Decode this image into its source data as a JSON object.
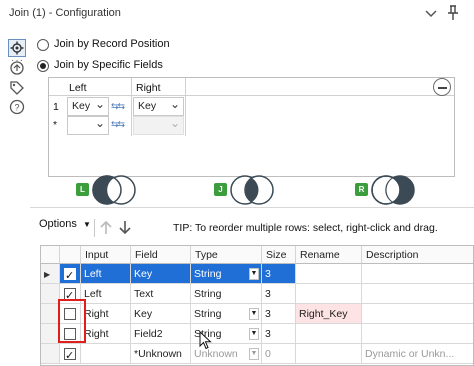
{
  "window": {
    "title": "Join (1) - Configuration"
  },
  "join_modes": {
    "record_position": "Join by Record Position",
    "specific_fields": "Join by Specific Fields"
  },
  "join_grid": {
    "headers": {
      "left": "Left",
      "right": "Right"
    },
    "rows": [
      {
        "num": "1",
        "left": "Key",
        "right": "Key"
      },
      {
        "num": "*",
        "left": "",
        "right": ""
      }
    ]
  },
  "venn": {
    "left_badge": "L",
    "join_badge": "J",
    "right_badge": "R"
  },
  "toolbar": {
    "options_label": "Options",
    "tip": "TIP: To reorder multiple rows: select, right-click and drag."
  },
  "table": {
    "columns": [
      "",
      "",
      "Input",
      "Field",
      "Type",
      "Size",
      "Rename",
      "Description"
    ],
    "rows": [
      {
        "selected": true,
        "checked": true,
        "input": "Left",
        "field": "Key",
        "type": "String",
        "size": "3",
        "rename": "",
        "description": ""
      },
      {
        "selected": false,
        "checked": true,
        "input": "Left",
        "field": "Text",
        "type": "String",
        "size": "3",
        "rename": "",
        "description": ""
      },
      {
        "selected": false,
        "checked": false,
        "input": "Right",
        "field": "Key",
        "type": "String",
        "size": "3",
        "rename": "Right_Key",
        "description": ""
      },
      {
        "selected": false,
        "checked": false,
        "input": "Right",
        "field": "Field2",
        "type": "String",
        "size": "3",
        "rename": "",
        "description": ""
      },
      {
        "selected": false,
        "checked": true,
        "input": "",
        "field": "*Unknown",
        "type": "Unknown",
        "size": "0",
        "rename": "",
        "description": "Dynamic or Unkn..."
      }
    ]
  },
  "colors": {
    "selection": "#1f6fd6",
    "highlight_box": "#e01e1e",
    "rename_fill": "#fde3e3",
    "badge_green": "#3b9d3b",
    "venn_dark": "#3b4a55"
  }
}
